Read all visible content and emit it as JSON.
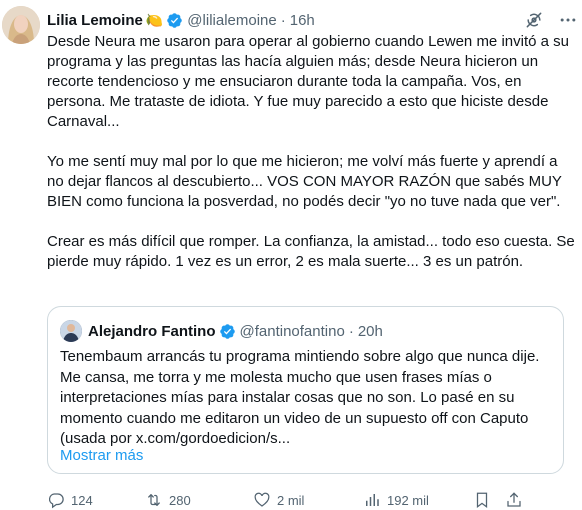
{
  "author": {
    "name": "Lilia Lemoine",
    "emoji": "🍋",
    "handle": "@lilialemoine",
    "separator": "·",
    "time": "16h"
  },
  "tweet_paragraphs": [
    "Desde Neura me usaron para operar al gobierno cuando Lewen me invitó a su programa y las preguntas las hacía alguien más; desde Neura hicieron un recorte tendencioso y me ensuciaron durante toda la campaña. Vos, en persona. Me trataste de idiota. Y fue muy parecido a esto que hiciste desde Carnaval...",
    "Yo me sentí muy mal por lo que me hicieron; me volví más fuerte y aprendí a no dejar flancos al descubierto... VOS CON MAYOR RAZÓN que sabés MUY BIEN como funciona la posverdad, no podés decir \"yo no tuve nada que ver\".",
    "Crear es más difícil que romper. La confianza, la amistad... todo eso cuesta. Se pierde muy rápido. 1 vez es un error, 2 es mala suerte... 3 es un patrón."
  ],
  "quote": {
    "name": "Alejandro Fantino",
    "handle": "@fantinofantino",
    "separator": "·",
    "time": "20h",
    "text": "Tenembaum arrancás tu programa mintiendo sobre algo que nunca dije.  Me cansa, me torra y me molesta mucho que usen  frases mías o interpretaciones mías para instalar cosas que no son. Lo pasé en su momento cuando me editaron un video de un supuesto off con Caputo (usada por x.com/gordoedicion/s...",
    "show_more": "Mostrar más"
  },
  "actions": {
    "replies": "124",
    "reposts": "280",
    "likes": "2 mil",
    "views": "192 mil"
  },
  "icons": [
    "verified-badge-icon",
    "grok-icon",
    "more-icon",
    "reply-icon",
    "repost-icon",
    "like-icon",
    "views-icon"
  ],
  "colors": {
    "accent": "#1d9bf0",
    "muted": "#536471",
    "border": "#cfd9de"
  }
}
